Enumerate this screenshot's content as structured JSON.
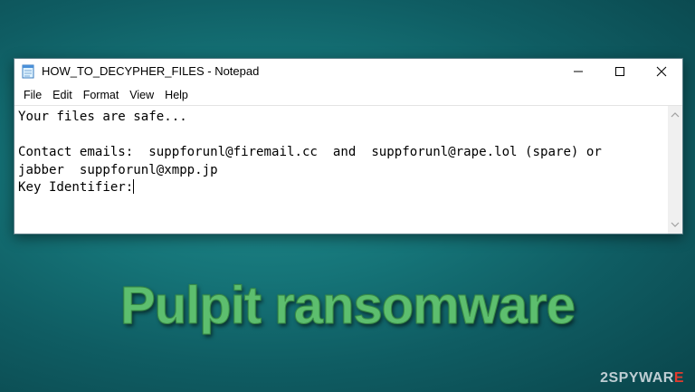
{
  "window": {
    "title": "HOW_TO_DECYPHER_FILES - Notepad",
    "icon": "notepad-icon"
  },
  "menu": {
    "items": [
      {
        "label": "File"
      },
      {
        "label": "Edit"
      },
      {
        "label": "Format"
      },
      {
        "label": "View"
      },
      {
        "label": "Help"
      }
    ]
  },
  "editor": {
    "lines": [
      "Your files are safe...",
      "",
      "Contact emails:  suppforunl@firemail.cc  and  suppforunl@rape.lol (spare) or",
      "jabber  suppforunl@xmpp.jp",
      "Key Identifier:"
    ]
  },
  "headline": "Pulpit ransomware",
  "watermark": {
    "prefix": "2",
    "middle": "SPYWAR",
    "suffix": "E"
  },
  "colors": {
    "background": "#157377",
    "headline": "#5dbe6e",
    "watermark_accent": "#e23b2e"
  }
}
